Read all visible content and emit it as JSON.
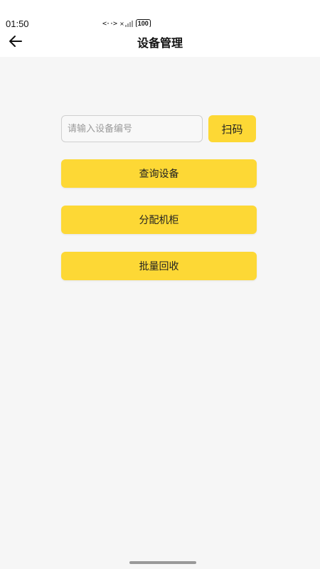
{
  "status_bar": {
    "time": "01:50",
    "network_glyph": "<··>",
    "signal_mark": "×",
    "battery": "100"
  },
  "header": {
    "title": "设备管理",
    "back_icon": "arrow-left-icon"
  },
  "search": {
    "placeholder": "请输入设备编号",
    "value": "",
    "scan_label": "扫码"
  },
  "actions": {
    "query_label": "查询设备",
    "assign_label": "分配机柜",
    "recycle_label": "批量回收"
  },
  "colors": {
    "accent": "#fdd835",
    "background": "#f6f6f6"
  }
}
